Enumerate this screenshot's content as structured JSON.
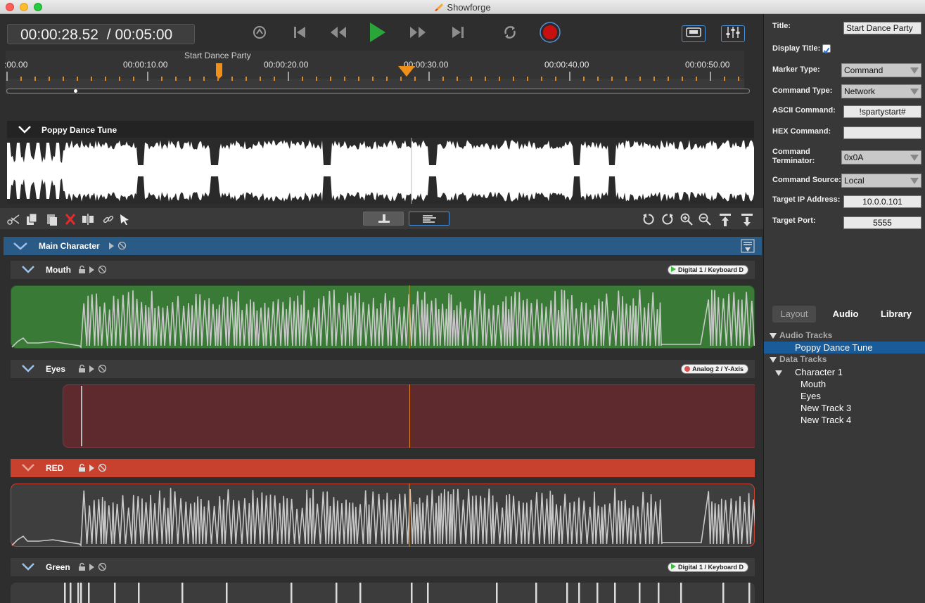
{
  "app": {
    "title": "Showforge"
  },
  "transport": {
    "current_time": "00:00:28.52",
    "total_time": "/ 00:05:00"
  },
  "ruler": {
    "marker_label": "Start Dance Party",
    "ticks": [
      ":00.00",
      "00:00:10.00",
      "00:00:20.00",
      "00:00:30.00",
      "00:00:40.00",
      "00:00:50.00"
    ]
  },
  "audio_track": {
    "name": "Poppy Dance Tune"
  },
  "group": {
    "name": "Main Character"
  },
  "tracks": [
    {
      "name": "Mouth",
      "badge": "Digital 1 / Keyboard D",
      "badge_icon": "play"
    },
    {
      "name": "Eyes",
      "badge": "Analog 2 / Y-Axis",
      "badge_icon": "record"
    },
    {
      "name": "RED",
      "badge": "",
      "badge_icon": ""
    },
    {
      "name": "Green",
      "badge": "Digital 1 / Keyboard D",
      "badge_icon": "play"
    }
  ],
  "properties": {
    "title_label": "Title:",
    "title_value": "Start Dance Party",
    "display_title_label": "Display Title:",
    "display_title_checked": true,
    "marker_type_label": "Marker Type:",
    "marker_type_value": "Command",
    "command_type_label": "Command Type:",
    "command_type_value": "Network",
    "ascii_label": "ASCII Command:",
    "ascii_value": "!spartystart#",
    "hex_label": "HEX Command:",
    "hex_value": "",
    "terminator_label": "Command Terminator:",
    "terminator_value": "0x0A",
    "source_label": "Command Source:",
    "source_value": "Local",
    "ip_label": "Target IP Address:",
    "ip_value": "10.0.0.101",
    "port_label": "Target Port:",
    "port_value": "5555"
  },
  "side_tabs": {
    "layout": "Layout",
    "audio": "Audio",
    "library": "Library"
  },
  "tree": {
    "audio_tracks": "Audio Tracks",
    "audio_item": "Poppy Dance Tune",
    "data_tracks": "Data Tracks",
    "character": "Character 1",
    "items": [
      "Mouth",
      "Eyes",
      "New Track 3",
      "New Track 4"
    ]
  },
  "colors": {
    "accent_blue": "#2a5a86",
    "selection_blue": "#1a5c9a",
    "mouth_green": "#3a7a37",
    "eyes_red": "#5e2a2e",
    "red_header": "#c8412e",
    "playhead_orange": "#e0851d",
    "play_green": "#2aa53a",
    "record_red": "#c81010"
  }
}
